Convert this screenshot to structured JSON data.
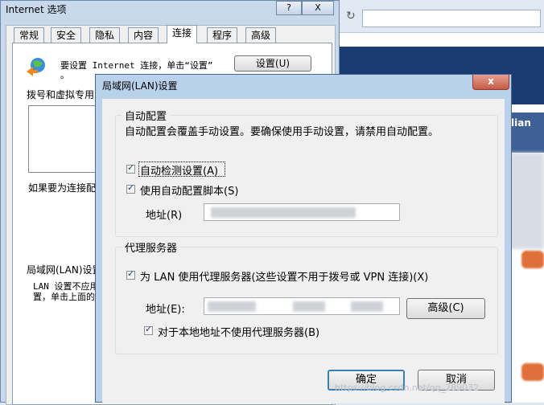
{
  "background_window": {
    "edge_text": "lian"
  },
  "internet_options": {
    "title": "Internet 选项",
    "help_button": "?",
    "close_button": "X",
    "tabs": [
      "常规",
      "安全",
      "隐私",
      "内容",
      "连接",
      "程序",
      "高级"
    ],
    "active_tab": "连接",
    "setup_text_line1": "要设置 Internet 连接，单击“设置”",
    "setup_text_line2": "。",
    "setup_button": "设置(U)",
    "dialup_label": "拨号和虚拟专用",
    "proxy_note": "如果要为连接配",
    "lan_section_label": "局域网(LAN)设置",
    "lan_note_line1": "LAN 设置不应用",
    "lan_note_line2": "置，单击上面的"
  },
  "lan_dialog": {
    "title": "局域网(LAN)设置",
    "close_label": "x",
    "auto_config": {
      "group_label": "自动配置",
      "description": "自动配置会覆盖手动设置。要确保使用手动设置，请禁用自动配置。",
      "auto_detect_label": "自动检测设置(A)",
      "auto_detect_checked": true,
      "use_script_label": "使用自动配置脚本(S)",
      "use_script_checked": true,
      "address_label": "地址(R)"
    },
    "proxy": {
      "group_label": "代理服务器",
      "use_proxy_label": "为 LAN 使用代理服务器(这些设置不用于拨号或 VPN 连接)(X)",
      "use_proxy_checked": true,
      "address_label": "地址(E):",
      "advanced_button": "高级(C)",
      "bypass_local_label": "对于本地地址不使用代理服务器(B)",
      "bypass_local_checked": true
    },
    "ok_button": "确定",
    "cancel_button": "取消"
  },
  "watermark": "https://blog.csdn.net/qq_289032"
}
